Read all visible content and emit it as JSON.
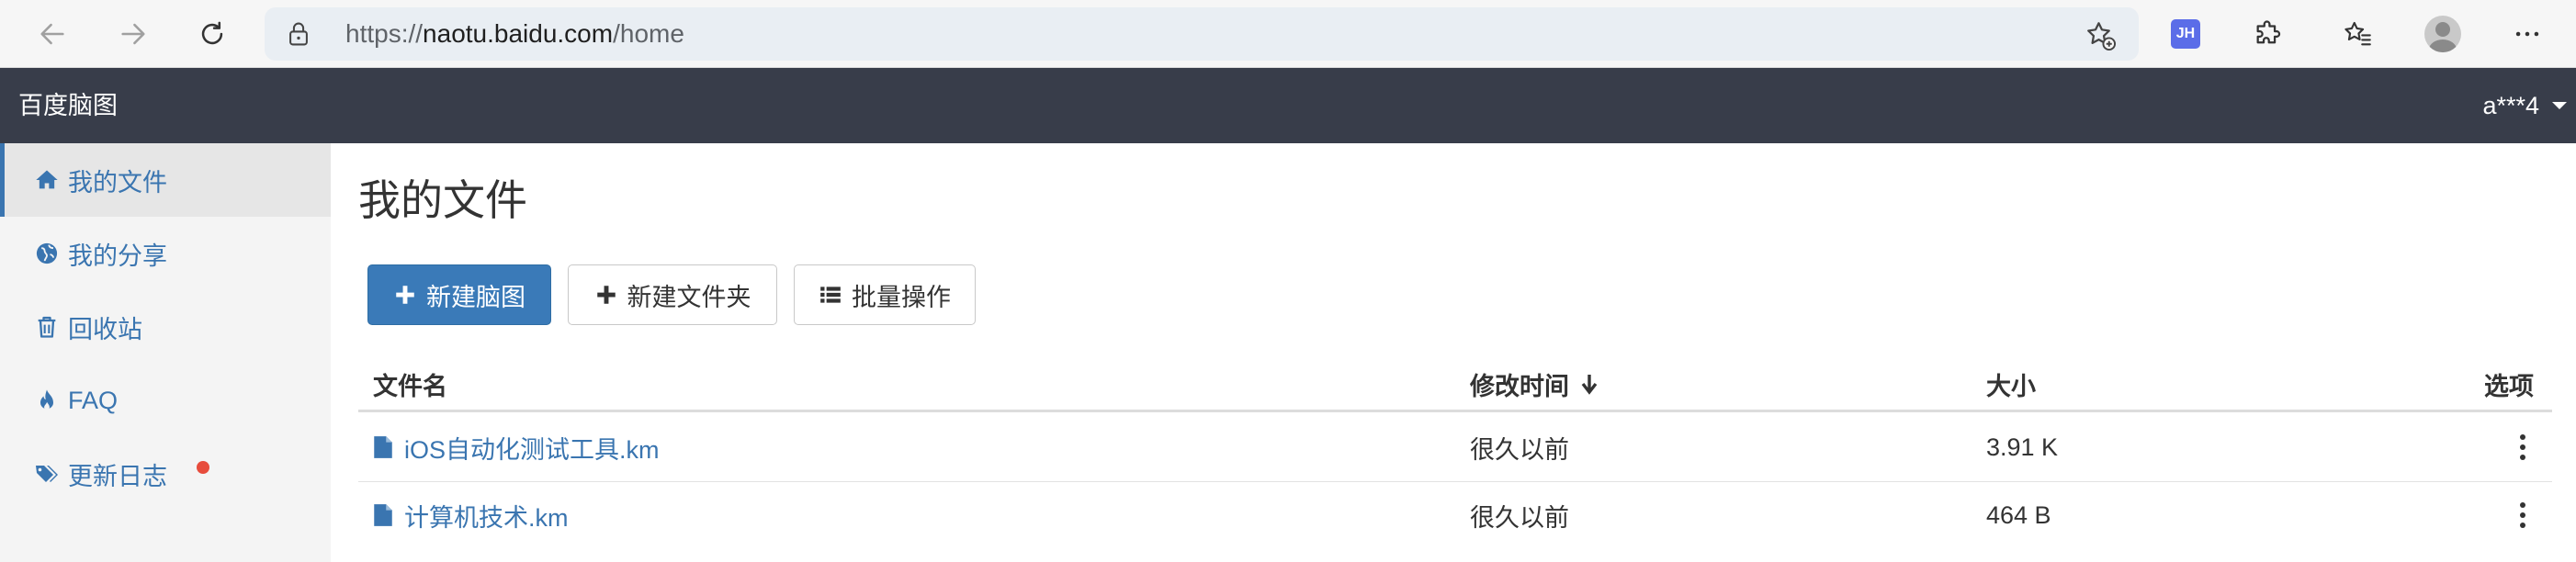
{
  "browser": {
    "url_prefix": "https://",
    "url_domain": "naotu.baidu.com",
    "url_path": "/home",
    "extension_badge": "JH"
  },
  "header": {
    "brand": "百度脑图",
    "user": "a***4"
  },
  "sidebar": {
    "items": [
      {
        "label": "我的文件",
        "icon": "home-icon",
        "active": true
      },
      {
        "label": "我的分享",
        "icon": "globe-icon",
        "active": false
      },
      {
        "label": "回收站",
        "icon": "trash-icon",
        "active": false
      },
      {
        "label": "FAQ",
        "icon": "fire-icon",
        "active": false
      },
      {
        "label": "更新日志",
        "icon": "tags-icon",
        "active": false,
        "badge_dot": true
      }
    ]
  },
  "main": {
    "title": "我的文件",
    "buttons": {
      "new_mindmap": "新建脑图",
      "new_folder": "新建文件夹",
      "batch": "批量操作"
    },
    "table": {
      "columns": [
        "文件名",
        "修改时间",
        "大小",
        "选项"
      ],
      "sort_column": "修改时间",
      "sort_direction": "desc",
      "rows": [
        {
          "name": "iOS自动化测试工具.km",
          "modified": "很久以前",
          "size": "3.91 K"
        },
        {
          "name": "计算机技术.km",
          "modified": "很久以前",
          "size": "464 B"
        }
      ]
    }
  },
  "colors": {
    "header_bg": "#383d4a",
    "primary": "#3a7ab8",
    "link": "#3a75b0",
    "badge_dot": "#e74c3c"
  }
}
